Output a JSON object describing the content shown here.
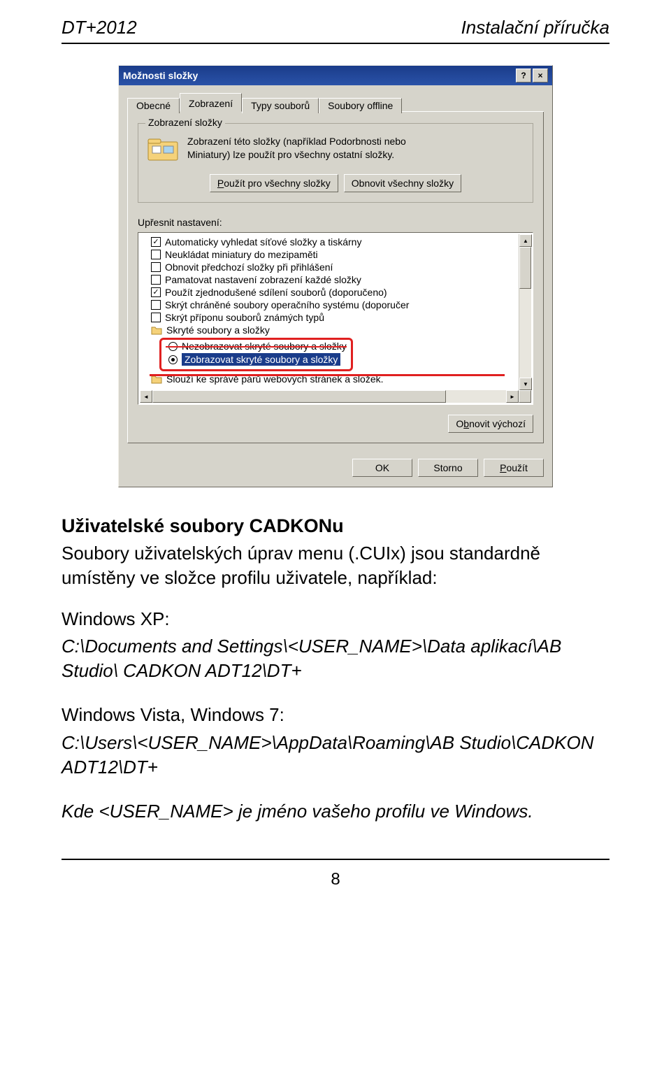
{
  "header": {
    "left": "DT+2012",
    "right": "Instalační příručka"
  },
  "dialog": {
    "title": "Možnosti složky",
    "helpBtn": "?",
    "closeBtn": "×",
    "tabs": [
      "Obecné",
      "Zobrazení",
      "Typy souborů",
      "Soubory offline"
    ],
    "activeTab": 1,
    "groupbox": {
      "title": "Zobrazení složky",
      "text1": "Zobrazení této složky (například Podorbnosti nebo",
      "text2": "Miniatury) lze použít pro všechny ostatní složky.",
      "btnApplyAll": "Použít pro všechny složky",
      "btnResetAll": "Obnovit všechny složky"
    },
    "advancedLabel": "Upřesnit nastavení:",
    "treeItems": [
      {
        "type": "check",
        "checked": true,
        "label": "Automaticky vyhledat síťové složky a tiskárny"
      },
      {
        "type": "check",
        "checked": false,
        "label": "Neukládat miniatury do mezipaměti"
      },
      {
        "type": "check",
        "checked": false,
        "label": "Obnovit předchozí složky při přihlášení"
      },
      {
        "type": "check",
        "checked": false,
        "label": "Pamatovat nastavení zobrazení každé složky"
      },
      {
        "type": "check",
        "checked": true,
        "label": "Použít zjednodušené sdílení souborů (doporučeno)"
      },
      {
        "type": "check",
        "checked": false,
        "label": "Skrýt chráněné soubory operačního systému (doporučer"
      },
      {
        "type": "check",
        "checked": false,
        "label": "Skrýt příponu souborů známých typů"
      },
      {
        "type": "folder",
        "label": "Skryté soubory a složky"
      },
      {
        "type": "radio",
        "checked": false,
        "label": "Nezobrazovat skryté soubory a složky",
        "strike": true
      },
      {
        "type": "radio",
        "checked": true,
        "label": "Zobrazovat skryté soubory a složky",
        "selected": true
      },
      {
        "type": "folder",
        "label": "Slouží ke správě párů webových stránek a složek.",
        "strikeTop": true
      }
    ],
    "restoreBtn": "Obnovit výchozí",
    "okBtn": "OK",
    "cancelBtn": "Storno",
    "applyBtn": "Použít"
  },
  "doc": {
    "heading": "Uživatelské soubory CADKONu",
    "p1": "Soubory uživatelských úprav menu (.CUIx) jsou standardně umístěny ve složce profilu uživatele, například:",
    "winxp": "Windows XP:",
    "pathxp": "C:\\Documents and Settings\\<USER_NAME>\\Data aplikací\\AB Studio\\ CADKON ADT12\\DT+",
    "winv7": "Windows Vista, Windows 7:",
    "pathv7": "C:\\Users\\<USER_NAME>\\AppData\\Roaming\\AB Studio\\CADKON ADT12\\DT+",
    "note": "Kde <USER_NAME> je jméno vašeho profilu ve Windows."
  },
  "pageNum": "8"
}
